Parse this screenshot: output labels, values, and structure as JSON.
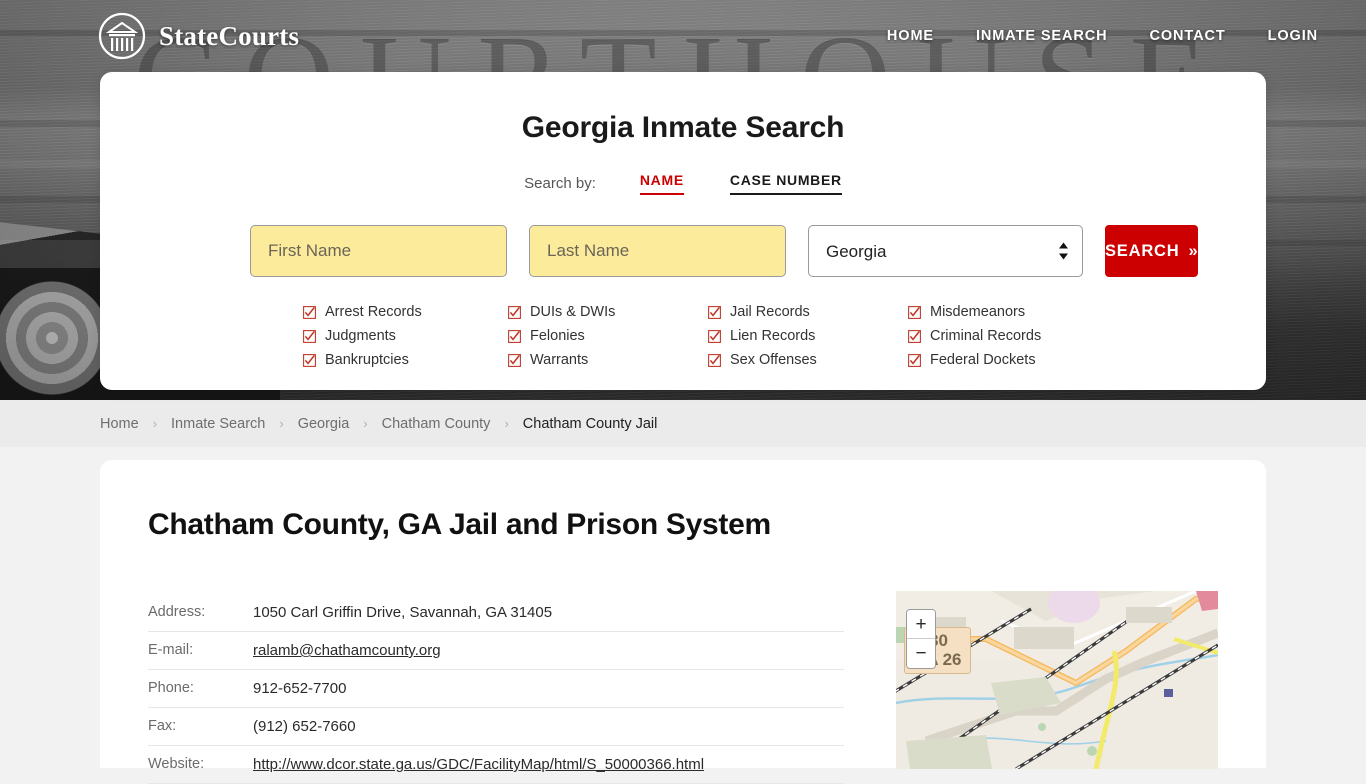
{
  "brand": {
    "name": "StateCourts",
    "logo_icon": "courthouse-circle-icon"
  },
  "hero": {
    "background_word": "COURTHOUSE"
  },
  "topnav": {
    "items": [
      {
        "label": "HOME"
      },
      {
        "label": "INMATE SEARCH"
      },
      {
        "label": "CONTACT"
      },
      {
        "label": "LOGIN"
      }
    ]
  },
  "search": {
    "title": "Georgia Inmate Search",
    "search_by_label": "Search by:",
    "tabs": [
      {
        "label": "NAME",
        "active": true,
        "color": "#cc0000"
      },
      {
        "label": "CASE NUMBER",
        "active": false,
        "color": "#1a1a1a"
      }
    ],
    "first_name_placeholder": "First Name",
    "first_name_value": "",
    "last_name_placeholder": "Last Name",
    "last_name_value": "",
    "state_selected": "Georgia",
    "state_options": [
      "Georgia"
    ],
    "submit_label": "SEARCH",
    "submit_chevron": "»",
    "input_bg": "#fdeb9c",
    "button_bg": "#cc0000",
    "record_types": [
      "Arrest Records",
      "DUIs & DWIs",
      "Jail Records",
      "Misdemeanors",
      "Judgments",
      "Felonies",
      "Lien Records",
      "Criminal Records",
      "Bankruptcies",
      "Warrants",
      "Sex Offenses",
      "Federal Dockets"
    ]
  },
  "breadcrumb": {
    "separator": "›",
    "items": [
      {
        "label": "Home",
        "current": false
      },
      {
        "label": "Inmate Search",
        "current": false
      },
      {
        "label": "Georgia",
        "current": false
      },
      {
        "label": "Chatham County",
        "current": false
      },
      {
        "label": "Chatham County Jail",
        "current": true
      }
    ]
  },
  "main": {
    "title": "Chatham County, GA Jail and Prison System",
    "details": [
      {
        "label": "Address:",
        "value": "1050 Carl Griffin Drive, Savannah, GA 31405",
        "link": false
      },
      {
        "label": "E-mail:",
        "value": "ralamb@chathamcounty.org",
        "link": true
      },
      {
        "label": "Phone:",
        "value": "912-652-7700",
        "link": false
      },
      {
        "label": "Fax:",
        "value": "(912) 652-7660",
        "link": false
      },
      {
        "label": "Website:",
        "value": "http://www.dcor.state.ga.us/GDC/FacilityMap/html/S_50000366.html",
        "link": true
      }
    ]
  },
  "map": {
    "zoom_in_label": "+",
    "zoom_out_label": "−",
    "road_shield": "S 80\nGA 26",
    "road_shield_line1": "S 80",
    "road_shield_line2": "GA 26"
  }
}
